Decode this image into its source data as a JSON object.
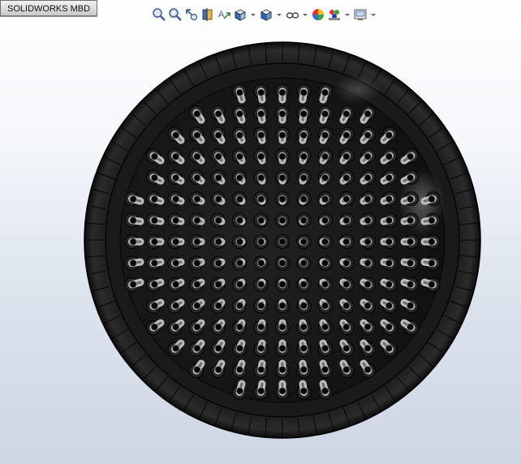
{
  "tab": {
    "label": "SOLIDWORKS MBD"
  },
  "toolbar": {
    "buttons": [
      {
        "name": "zoom-to-fit-icon"
      },
      {
        "name": "zoom-to-area-icon"
      },
      {
        "name": "previous-view-icon"
      },
      {
        "name": "section-view-icon"
      },
      {
        "name": "dynamic-annotation-views-icon"
      },
      {
        "name": "view-orientation-icon",
        "dropdown": true
      },
      {
        "name": "display-style-icon",
        "dropdown": true
      },
      {
        "name": "hide-show-items-icon",
        "dropdown": true
      },
      {
        "name": "edit-appearance-icon"
      },
      {
        "name": "apply-scene-icon",
        "dropdown": true
      },
      {
        "name": "view-settings-icon",
        "dropdown": true
      }
    ]
  },
  "model": {
    "description_colors": {
      "body": "#161616",
      "highlight": "#cfcfcf"
    }
  }
}
